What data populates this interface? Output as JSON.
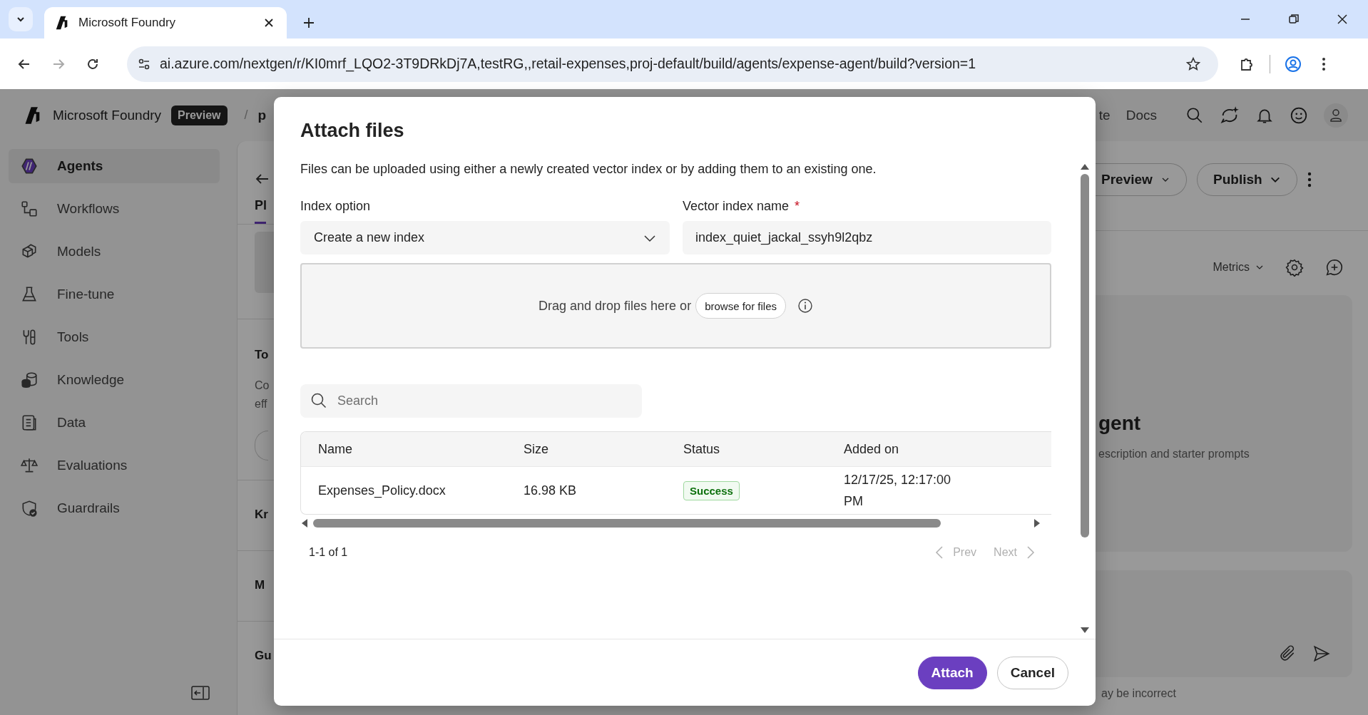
{
  "browser": {
    "tab_title": "Microsoft Foundry",
    "url": "ai.azure.com/nextgen/r/KI0mrf_LQO2-3T9DRkDj7A,testRG,,retail-expenses,proj-default/build/agents/expense-agent/build?version=1"
  },
  "header": {
    "brand": "Microsoft Foundry",
    "badge": "Preview",
    "separator": "/",
    "crumb": "p",
    "nav_cut": "te",
    "docs": "Docs"
  },
  "sidebar": {
    "items": [
      {
        "label": "Agents",
        "selected": true
      },
      {
        "label": "Workflows",
        "selected": false
      },
      {
        "label": "Models",
        "selected": false
      },
      {
        "label": "Fine-tune",
        "selected": false
      },
      {
        "label": "Tools",
        "selected": false
      },
      {
        "label": "Knowledge",
        "selected": false
      },
      {
        "label": "Data",
        "selected": false
      },
      {
        "label": "Evaluations",
        "selected": false
      },
      {
        "label": "Guardrails",
        "selected": false
      }
    ]
  },
  "background": {
    "tab": "Pl",
    "section_1": "To",
    "text_lines": [
      "Co",
      "eff"
    ],
    "section_2": "Kr",
    "section_3": "M",
    "section_4": "Gu",
    "preview_button": "Preview",
    "publish_button": "Publish",
    "metrics": "Metrics",
    "heading": "gent",
    "subtitle": "escription and starter prompts",
    "disclaimer": "ay be incorrect"
  },
  "dialog": {
    "title": "Attach files",
    "description": "Files can be uploaded using either a newly created vector index or by adding them to an existing one.",
    "index_option": {
      "label": "Index option",
      "value": "Create a new index"
    },
    "vector_index": {
      "label": "Vector index name",
      "required_mark": "*",
      "value": "index_quiet_jackal_ssyh9l2qbz"
    },
    "dropzone": {
      "text": "Drag and drop files here or",
      "browse": "browse for files"
    },
    "search": {
      "placeholder": "Search"
    },
    "table": {
      "columns": [
        "Name",
        "Size",
        "Status",
        "Added on"
      ],
      "rows": [
        {
          "cells": [
            "Expenses_Policy.docx",
            "16.98 KB",
            "Success",
            "12/17/25, 12:17:00 PM"
          ]
        }
      ]
    },
    "pagination": {
      "range": "1-1 of 1",
      "prev": {
        "label": "Prev",
        "disabled": true
      },
      "next": {
        "label": "Next",
        "disabled": true
      }
    },
    "buttons": [
      {
        "label": "Attach",
        "kind": "primary"
      },
      {
        "label": "Cancel",
        "kind": "secondary"
      }
    ]
  }
}
